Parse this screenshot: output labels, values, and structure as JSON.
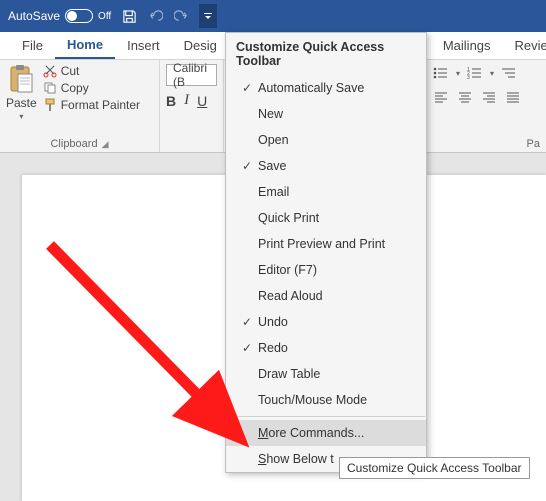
{
  "titlebar": {
    "autosave_label": "AutoSave",
    "autosave_state": "Off"
  },
  "tabs": {
    "file": "File",
    "home": "Home",
    "insert": "Insert",
    "design": "Desig",
    "mailings": "Mailings",
    "review": "Review"
  },
  "ribbon": {
    "clipboard": {
      "paste": "Paste",
      "cut": "Cut",
      "copy": "Copy",
      "format_painter": "Format Painter",
      "group_label": "Clipboard"
    },
    "font": {
      "name": "Calibri (B",
      "bold": "B",
      "italic": "I",
      "underline": "U"
    },
    "paragraph": {
      "group_label_partial": "Pa"
    }
  },
  "menu": {
    "title": "Customize Quick Access Toolbar",
    "items": [
      {
        "label": "Automatically Save",
        "checked": true
      },
      {
        "label": "New",
        "checked": false
      },
      {
        "label": "Open",
        "checked": false
      },
      {
        "label": "Save",
        "checked": true
      },
      {
        "label": "Email",
        "checked": false
      },
      {
        "label": "Quick Print",
        "checked": false
      },
      {
        "label": "Print Preview and Print",
        "checked": false
      },
      {
        "label": "Editor (F7)",
        "checked": false
      },
      {
        "label": "Read Aloud",
        "checked": false
      },
      {
        "label": "Undo",
        "checked": true
      },
      {
        "label": "Redo",
        "checked": true
      },
      {
        "label": "Draw Table",
        "checked": false
      },
      {
        "label": "Touch/Mouse Mode",
        "checked": false
      }
    ],
    "more_commands_pre": "M",
    "more_commands_post": "ore Commands...",
    "show_below_pre": "S",
    "show_below_post": "how Below t"
  },
  "tooltip": "Customize Quick Access Toolbar"
}
